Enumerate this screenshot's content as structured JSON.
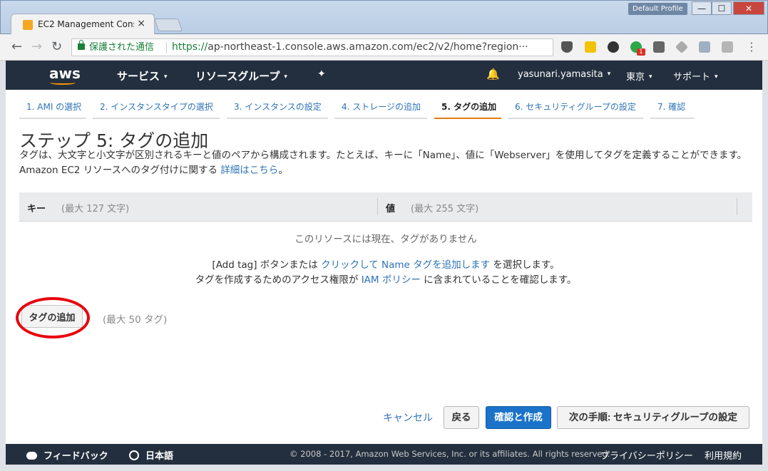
{
  "browser": {
    "tab_title": "EC2 Management Cons",
    "tab_close": "×",
    "profile": "Default Profile",
    "minimize": "—",
    "maximize": "☐",
    "close": "✕",
    "back_icon": "←",
    "forward_icon": "→",
    "reload_icon": "↻",
    "secure_label": "保護された通信",
    "url_green": "https://",
    "url_host": "ap-northeast-1.console.aws.amazon.com",
    "url_path": "/ec2/v2/home?region···",
    "star_icon": "☆",
    "menu_icon": "⋮",
    "ext_badge": "1"
  },
  "aws_nav": {
    "logo": "aws",
    "services": "サービス",
    "resource_groups": "リソースグループ",
    "pin_icon": "✦",
    "bell_icon": "🔔",
    "user": "yasunari.yamasita",
    "region": "東京",
    "support": "サポート",
    "caret": "▾"
  },
  "wizard": {
    "steps": [
      {
        "label": "1. AMI の選択",
        "active": false
      },
      {
        "label": "2. インスタンスタイプの選択",
        "active": false
      },
      {
        "label": "3. インスタンスの設定",
        "active": false
      },
      {
        "label": "4. ストレージの追加",
        "active": false
      },
      {
        "label": "5. タグの追加",
        "active": true
      },
      {
        "label": "6. セキュリティグループの設定",
        "active": false
      },
      {
        "label": "7. 確認",
        "active": false
      }
    ]
  },
  "page": {
    "title": "ステップ 5: タグの追加",
    "desc_text": "タグは、大文字と小文字が区別されるキーと値のペアから構成されます。たとえば、キーに「Name」、値に「Webserver」を使用してタグを定義することができます。Amazon EC2 リソースへのタグ付けに関する ",
    "desc_link": "詳細はこちら",
    "desc_end": "。"
  },
  "table": {
    "key_label": "キー",
    "key_hint": "(最大 127 文字)",
    "value_label": "値",
    "value_hint": "(最大 255 文字)",
    "empty": "このリソースには現在、タグがありません",
    "instr1_pre": "[Add tag] ボタンまたは ",
    "instr1_link": "クリックして Name タグを追加します",
    "instr1_post": " を選択します。",
    "instr2_pre": "タグを作成するためのアクセス権限が ",
    "instr2_link": "IAM ポリシー",
    "instr2_post": " に含まれていることを確認します。"
  },
  "actions": {
    "add_tag": "タグの追加",
    "max_tags": "(最大 50 タグ)",
    "cancel": "キャンセル",
    "back": "戻る",
    "review_launch": "確認と作成",
    "next": "次の手順: セキュリティグループの設定"
  },
  "footer": {
    "feedback": "フィードバック",
    "language": "日本語",
    "copyright": "© 2008 - 2017, Amazon Web Services, Inc. or its affiliates. All rights reserved.",
    "privacy": "プライバシーポリシー",
    "terms": "利用規約"
  },
  "colors": {
    "aws_navy": "#232f3e",
    "aws_orange": "#ff9900",
    "link_blue": "#2e73b8",
    "primary_blue": "#1a73c9",
    "active_tab_underline": "#e47911",
    "annotation_red": "#e8000b"
  }
}
